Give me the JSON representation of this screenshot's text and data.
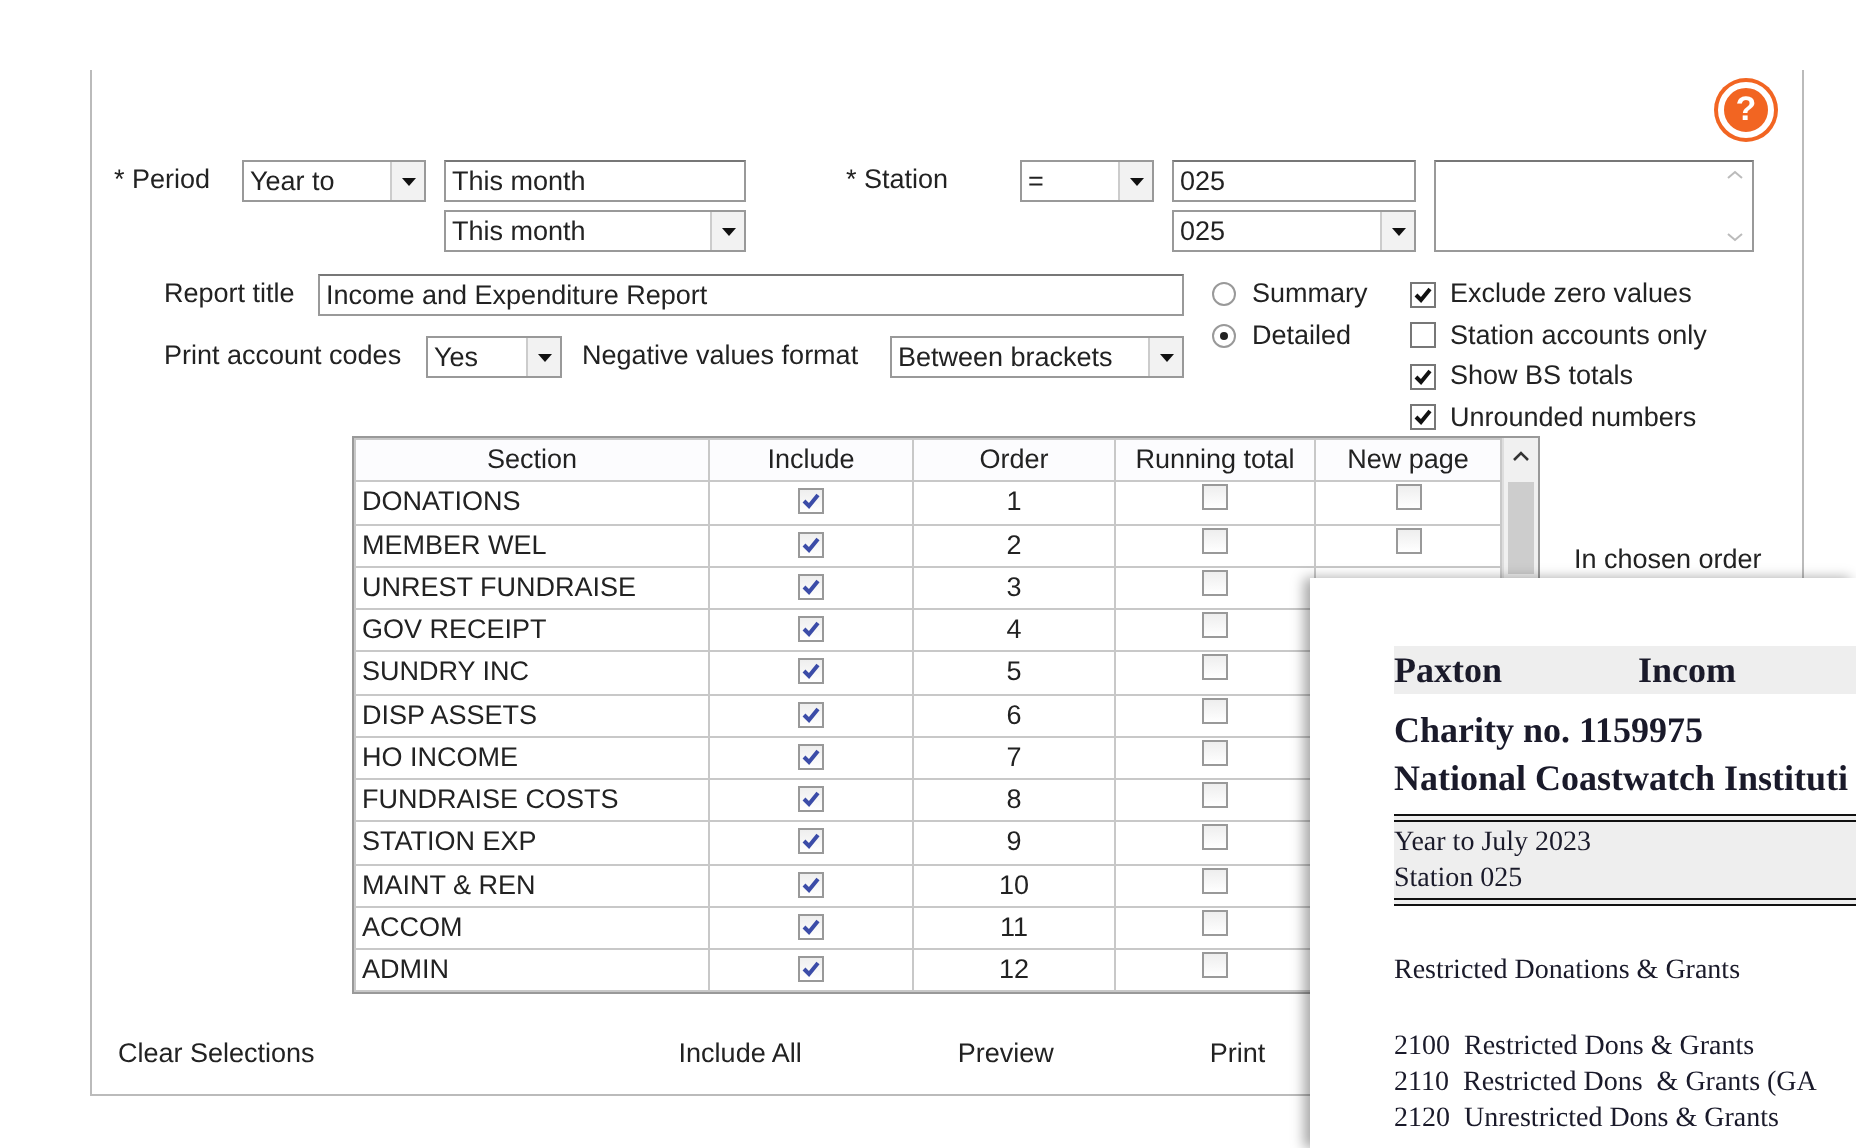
{
  "help_button": {
    "label": "?"
  },
  "period": {
    "label": "* Period",
    "mode": "Year to",
    "from": "This month",
    "to": "This month"
  },
  "station": {
    "label": "* Station",
    "operator": "=",
    "from": "025",
    "to": "025"
  },
  "report_title": {
    "label": "Report title",
    "value": "Income and Expenditure Report"
  },
  "print_account_codes": {
    "label": "Print account codes",
    "value": "Yes"
  },
  "negative_values_format": {
    "label": "Negative values format",
    "value": "Between brackets"
  },
  "layout_options": [
    {
      "label": "Summary",
      "selected": false
    },
    {
      "label": "Detailed",
      "selected": true
    }
  ],
  "options": [
    {
      "label": "Exclude zero values",
      "checked": true
    },
    {
      "label": "Station accounts only",
      "checked": false
    },
    {
      "label": "Show BS totals",
      "checked": true
    },
    {
      "label": "Unrounded numbers",
      "checked": true
    }
  ],
  "table": {
    "columns": [
      "Section",
      "Include",
      "Order",
      "Running total",
      "New page"
    ],
    "rows": [
      {
        "section": "DONATIONS",
        "include": true,
        "order": "1",
        "running_total": false,
        "new_page": false
      },
      {
        "section": "MEMBER WEL",
        "include": true,
        "order": "2",
        "running_total": false,
        "new_page": false
      },
      {
        "section": "UNREST FUNDRAISE",
        "include": true,
        "order": "3",
        "running_total": false
      },
      {
        "section": "GOV RECEIPT",
        "include": true,
        "order": "4",
        "running_total": false
      },
      {
        "section": "SUNDRY INC",
        "include": true,
        "order": "5",
        "running_total": false
      },
      {
        "section": "DISP ASSETS",
        "include": true,
        "order": "6",
        "running_total": false
      },
      {
        "section": "HO INCOME",
        "include": true,
        "order": "7",
        "running_total": false
      },
      {
        "section": "FUNDRAISE COSTS",
        "include": true,
        "order": "8",
        "running_total": false
      },
      {
        "section": "STATION EXP",
        "include": true,
        "order": "9",
        "running_total": false
      },
      {
        "section": "MAINT & REN",
        "include": true,
        "order": "10",
        "running_total": false
      },
      {
        "section": "ACCOM",
        "include": true,
        "order": "11",
        "running_total": false
      },
      {
        "section": "ADMIN",
        "include": true,
        "order": "12",
        "running_total": false
      }
    ]
  },
  "side_note": "In chosen order",
  "buttons": [
    "Clear Selections",
    "Include All",
    "Preview",
    "Print"
  ],
  "preview": {
    "company": "Paxton",
    "report_heading": "Incom",
    "charity": "Charity no. 1159975",
    "organisation": "National Coastwatch Instituti",
    "period": "Year to July 2023",
    "station": "Station 025",
    "section_heading": "Restricted Donations & Grants",
    "accounts": [
      {
        "code": "2100",
        "name": "Restricted Dons & Grants"
      },
      {
        "code": "2110",
        "name": "Restricted Dons  & Grants (GA"
      },
      {
        "code": "2120",
        "name": "Unrestricted Dons & Grants"
      }
    ]
  }
}
